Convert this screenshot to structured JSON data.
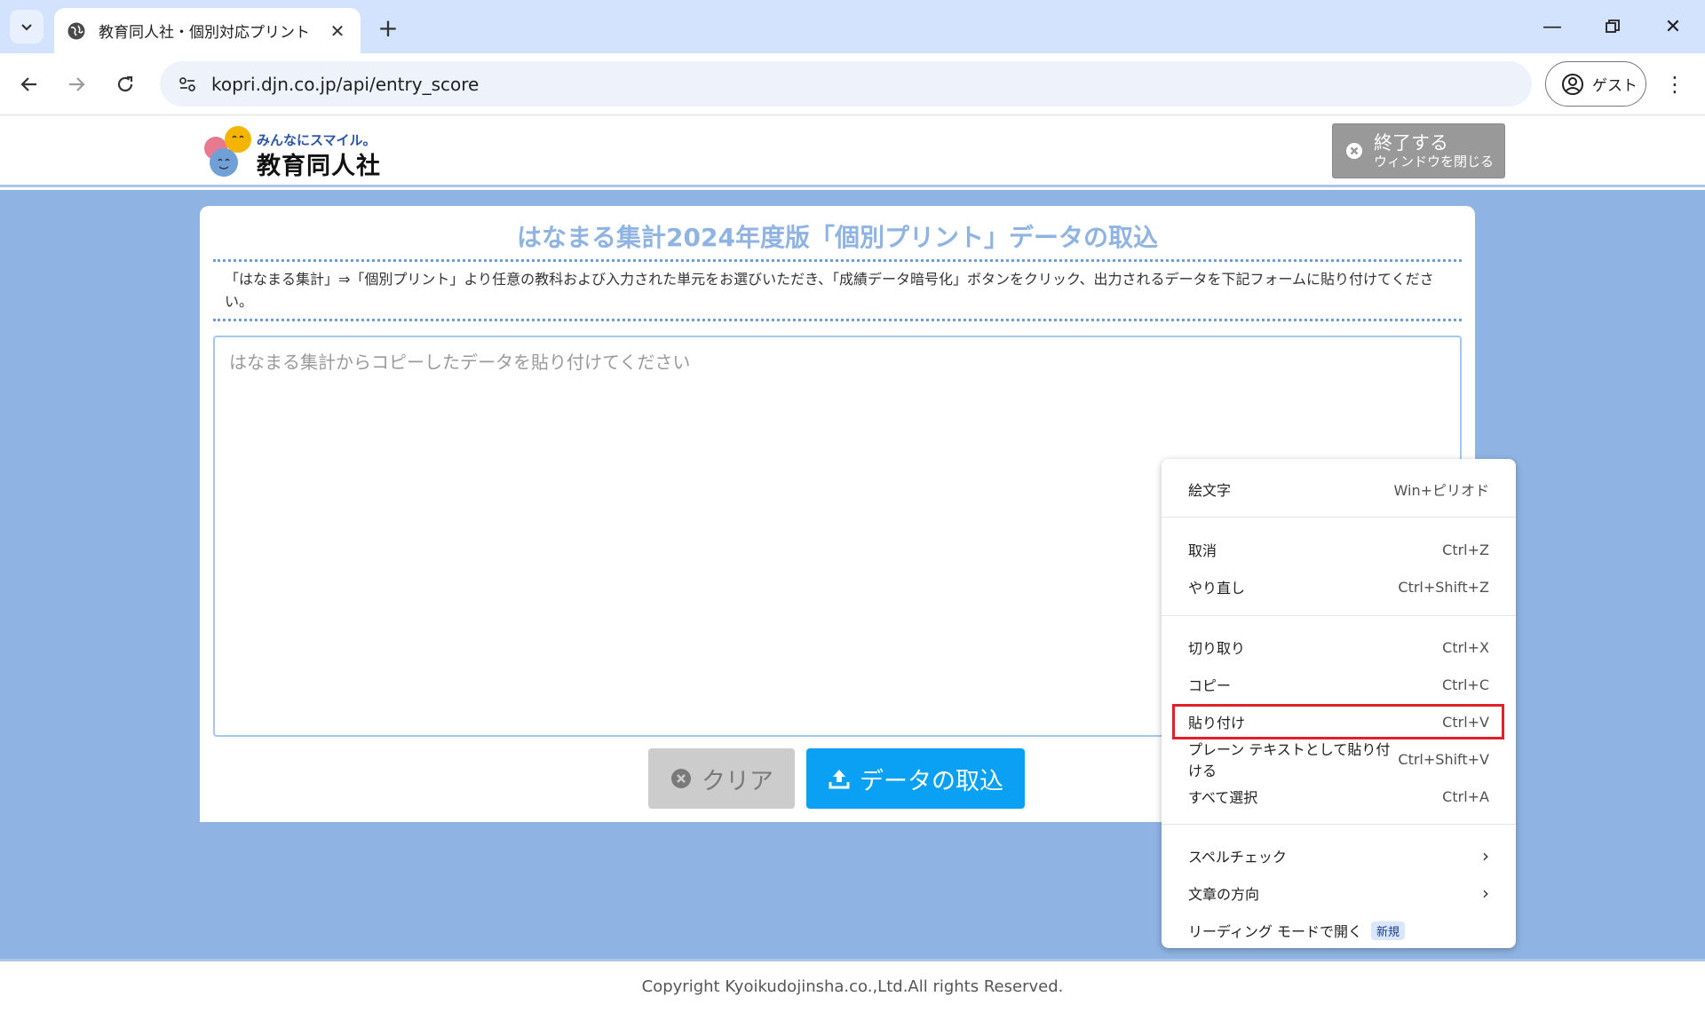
{
  "browser": {
    "tab_title": "教育同人社・個別対応プリント",
    "url": "kopri.djn.co.jp/api/entry_score",
    "profile_label": "ゲスト",
    "new_tab_label": "+"
  },
  "header": {
    "logo_tagline": "みんなにスマイル。",
    "logo_company": "教育同人社",
    "exit_main": "終了する",
    "exit_sub": "ウィンドウを閉じる"
  },
  "main": {
    "title": "はなまる集計2024年度版「個別プリント」データの取込",
    "description": "「はなまる集計」⇒「個別プリント」より任意の教科および入力された単元をお選びいただき、「成績データ暗号化」ボタンをクリック、出力されるデータを下記フォームに貼り付けてください。",
    "textarea_placeholder": "はなまる集計からコピーしたデータを貼り付けてください",
    "clear_label": "クリア",
    "import_label": "データの取込"
  },
  "footer": {
    "copyright": "Copyright Kyoikudojinsha.co.,Ltd.All rights Reserved."
  },
  "context_menu": {
    "items": [
      {
        "label": "絵文字",
        "shortcut": "Win+ピリオド"
      },
      {
        "label": "取消",
        "shortcut": "Ctrl+Z"
      },
      {
        "label": "やり直し",
        "shortcut": "Ctrl+Shift+Z"
      },
      {
        "label": "切り取り",
        "shortcut": "Ctrl+X"
      },
      {
        "label": "コピー",
        "shortcut": "Ctrl+C"
      },
      {
        "label": "貼り付け",
        "shortcut": "Ctrl+V"
      },
      {
        "label": "プレーン テキストとして貼り付ける",
        "shortcut": "Ctrl+Shift+V"
      },
      {
        "label": "すべて選択",
        "shortcut": "Ctrl+A"
      },
      {
        "label": "スペルチェック",
        "shortcut": ""
      },
      {
        "label": "文章の方向",
        "shortcut": ""
      },
      {
        "label": "リーディング モードで開く",
        "shortcut": ""
      }
    ],
    "new_badge": "新規",
    "highlight_color": "#e0202a"
  }
}
